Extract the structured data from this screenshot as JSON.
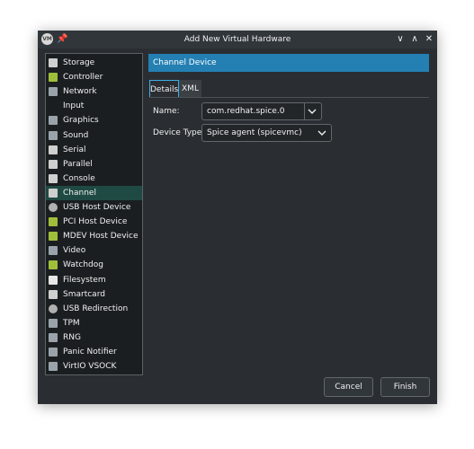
{
  "window": {
    "title": "Add New Virtual Hardware"
  },
  "devices": [
    {
      "label": "Storage",
      "icon": "storage-icon",
      "color": "#cfcfcf"
    },
    {
      "label": "Controller",
      "icon": "controller-icon",
      "color": "#9fbf3a"
    },
    {
      "label": "Network",
      "icon": "network-icon",
      "color": "#9aa3ab"
    },
    {
      "label": "Input",
      "icon": "",
      "color": ""
    },
    {
      "label": "Graphics",
      "icon": "graphics-icon",
      "color": "#9aa3ab"
    },
    {
      "label": "Sound",
      "icon": "sound-icon",
      "color": "#9aa3ab"
    },
    {
      "label": "Serial",
      "icon": "serial-icon",
      "color": "#cfcfcf"
    },
    {
      "label": "Parallel",
      "icon": "parallel-icon",
      "color": "#cfcfcf"
    },
    {
      "label": "Console",
      "icon": "console-icon",
      "color": "#cfcfcf"
    },
    {
      "label": "Channel",
      "icon": "channel-icon",
      "color": "#cfcfcf"
    },
    {
      "label": "USB Host Device",
      "icon": "usb-icon",
      "color": "#b0b0b0"
    },
    {
      "label": "PCI Host Device",
      "icon": "pci-icon",
      "color": "#9fbf3a"
    },
    {
      "label": "MDEV Host Device",
      "icon": "mdev-icon",
      "color": "#9fbf3a"
    },
    {
      "label": "Video",
      "icon": "video-icon",
      "color": "#9aa3ab"
    },
    {
      "label": "Watchdog",
      "icon": "watchdog-icon",
      "color": "#9fbf3a"
    },
    {
      "label": "Filesystem",
      "icon": "filesystem-icon",
      "color": "#e6e6e6"
    },
    {
      "label": "Smartcard",
      "icon": "smartcard-icon",
      "color": "#cfcfcf"
    },
    {
      "label": "USB Redirection",
      "icon": "usb-redirection-icon",
      "color": "#b0b0b0"
    },
    {
      "label": "TPM",
      "icon": "tpm-icon",
      "color": "#9aa3ab"
    },
    {
      "label": "RNG",
      "icon": "rng-icon",
      "color": "#9aa3ab"
    },
    {
      "label": "Panic Notifier",
      "icon": "panic-notifier-icon",
      "color": "#9aa3ab"
    },
    {
      "label": "VirtIO VSOCK",
      "icon": "vsock-icon",
      "color": "#9aa3ab"
    }
  ],
  "selected_device": "Channel",
  "panel": {
    "header": "Channel Device",
    "tabs": [
      "Details",
      "XML"
    ],
    "active_tab": "Details",
    "name_label": "Name:",
    "name_value": "com.redhat.spice.0",
    "device_type_label": "Device Type:",
    "device_type_value": "Spice agent (spicevmc)"
  },
  "buttons": {
    "cancel": "Cancel",
    "finish": "Finish"
  },
  "colors": {
    "accent": "#2480b3",
    "selection": "#1f4a43",
    "window_bg": "#2a2e32",
    "tab_focus": "#3daee9"
  }
}
